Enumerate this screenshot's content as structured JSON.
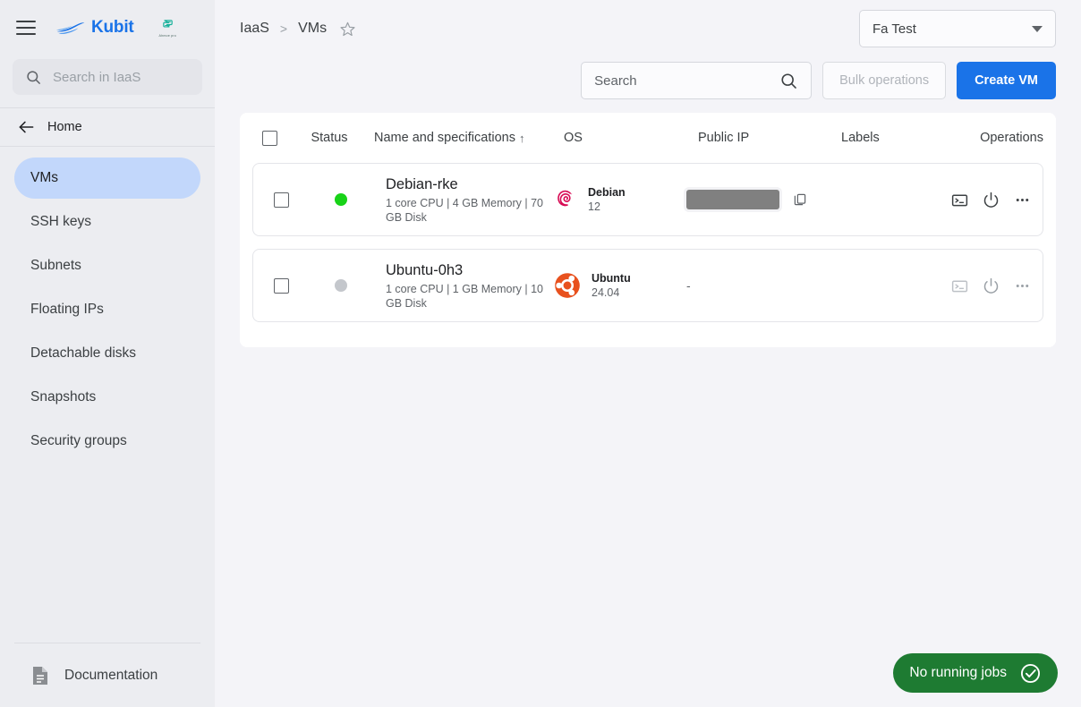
{
  "sidebar": {
    "menu_icon": "hamburger-icon",
    "brand": "Kubit",
    "partner_caption": "Ahmoe pro",
    "search_placeholder": "Search in IaaS",
    "search_icon": "search-icon",
    "back_icon": "arrow-left-icon",
    "home_label": "Home",
    "items": [
      {
        "label": "VMs",
        "active": true
      },
      {
        "label": "SSH keys",
        "active": false
      },
      {
        "label": "Subnets",
        "active": false
      },
      {
        "label": "Floating IPs",
        "active": false
      },
      {
        "label": "Detachable disks",
        "active": false
      },
      {
        "label": "Snapshots",
        "active": false
      },
      {
        "label": "Security groups",
        "active": false
      }
    ],
    "footer": {
      "label": "Documentation",
      "icon": "document-icon"
    }
  },
  "topbar": {
    "breadcrumb": {
      "root": "IaaS",
      "separator": ">",
      "current": "VMs",
      "favorite_icon": "star-outline-icon"
    },
    "project_select": {
      "value": "Fa Test",
      "icon": "chevron-down-icon"
    }
  },
  "actions": {
    "search_placeholder": "Search",
    "search_icon": "search-icon",
    "bulk_label": "Bulk operations",
    "bulk_disabled": true,
    "create_label": "Create VM"
  },
  "table": {
    "select_all_icon": "checkbox-unchecked-icon",
    "headers": {
      "status": "Status",
      "name": "Name and specifications",
      "sort_indicator": "↑",
      "os": "OS",
      "public_ip": "Public IP",
      "labels": "Labels",
      "operations": "Operations"
    },
    "rows": [
      {
        "checkbox_icon": "checkbox-unchecked-icon",
        "status": "running",
        "status_color": "#18d318",
        "name": "Debian-rke",
        "specs": "1 core CPU | 4 GB Memory | 70 GB Disk",
        "os_name": "Debian",
        "os_version": "12",
        "os_icon": "debian-logo-icon",
        "public_ip": "",
        "public_ip_redacted": true,
        "copy_icon": "copy-icon",
        "labels": "",
        "ops": [
          {
            "icon": "console-icon",
            "enabled": true
          },
          {
            "icon": "power-icon",
            "enabled": true
          },
          {
            "icon": "more-options-icon",
            "enabled": true
          }
        ]
      },
      {
        "checkbox_icon": "checkbox-unchecked-icon",
        "status": "stopped",
        "status_color": "#c4c7cc",
        "name": "Ubuntu-0h3",
        "specs": "1 core CPU | 1 GB Memory | 10 GB Disk",
        "os_name": "Ubuntu",
        "os_version": "24.04",
        "os_icon": "ubuntu-logo-icon",
        "public_ip": "-",
        "public_ip_redacted": false,
        "labels": "",
        "ops": [
          {
            "icon": "console-icon",
            "enabled": false
          },
          {
            "icon": "power-icon",
            "enabled": false
          },
          {
            "icon": "more-options-icon",
            "enabled": false
          }
        ]
      }
    ]
  },
  "annotation": {
    "type": "red-arrow",
    "points_to": "console-icon-row-1",
    "color": "#e02020"
  },
  "jobs_status": {
    "label": "No running jobs",
    "icon": "check-circle-icon",
    "color": "#1e7b32"
  }
}
